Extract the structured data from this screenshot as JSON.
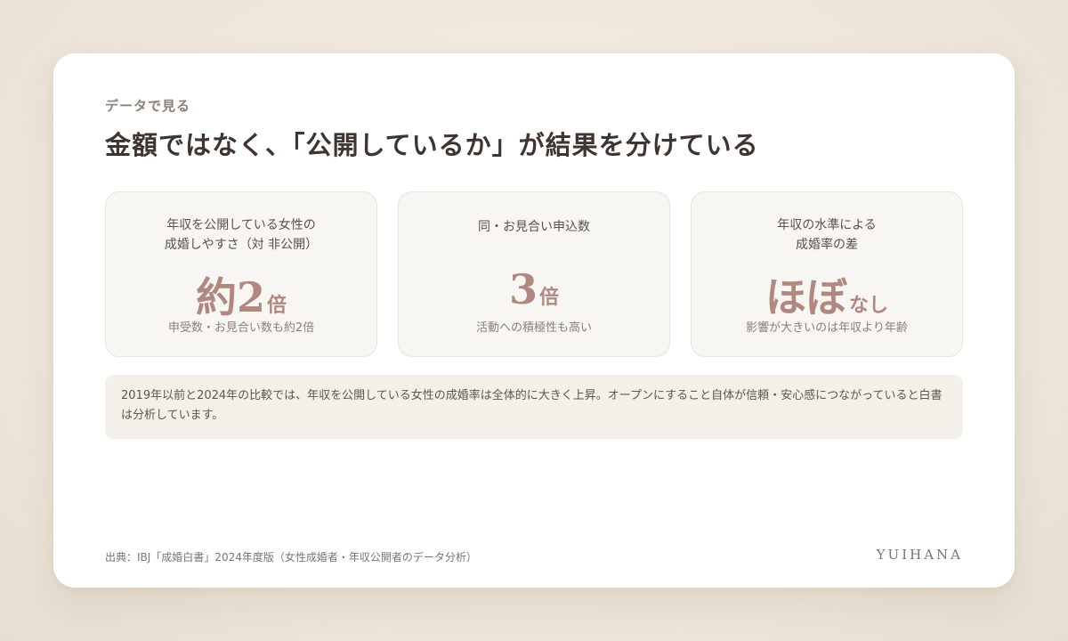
{
  "header": {
    "eyebrow": "データで見る",
    "title": "金額ではなく、「公開しているか」が結果を分けている"
  },
  "stats": [
    {
      "label_line1": "年収を公開している女性の",
      "label_line2": "成婚しやすさ（対 非公開）",
      "value": "約2",
      "unit": "倍",
      "sub": "申受数・お見合い数も約2倍"
    },
    {
      "label_line1": "同・お見合い申込数",
      "label_line2": "",
      "value": "3",
      "unit": "倍",
      "sub": "活動への積極性も高い"
    },
    {
      "label_line1": "年収の水準による",
      "label_line2": "成婚率の差",
      "value": "ほぼ",
      "unit": "なし",
      "sub": "影響が大きいのは年収より年齢"
    }
  ],
  "note": "2019年以前と2024年の比較では、年収を公開している女性の成婚率は全体的に大きく上昇。オープンにすること自体が信頼・安心感につながっていると白書は分析しています。",
  "footer": {
    "source": "出典：IBJ「成婚白書」2024年度版（女性成婚者・年収公開者のデータ分析）",
    "brand": "YUIHANA"
  },
  "colors": {
    "accent": "#b08880",
    "title": "#3e3530",
    "card_bg": "#ffffff",
    "stat_bg": "#f8f6f2",
    "note_bg": "#f3f0e9"
  }
}
